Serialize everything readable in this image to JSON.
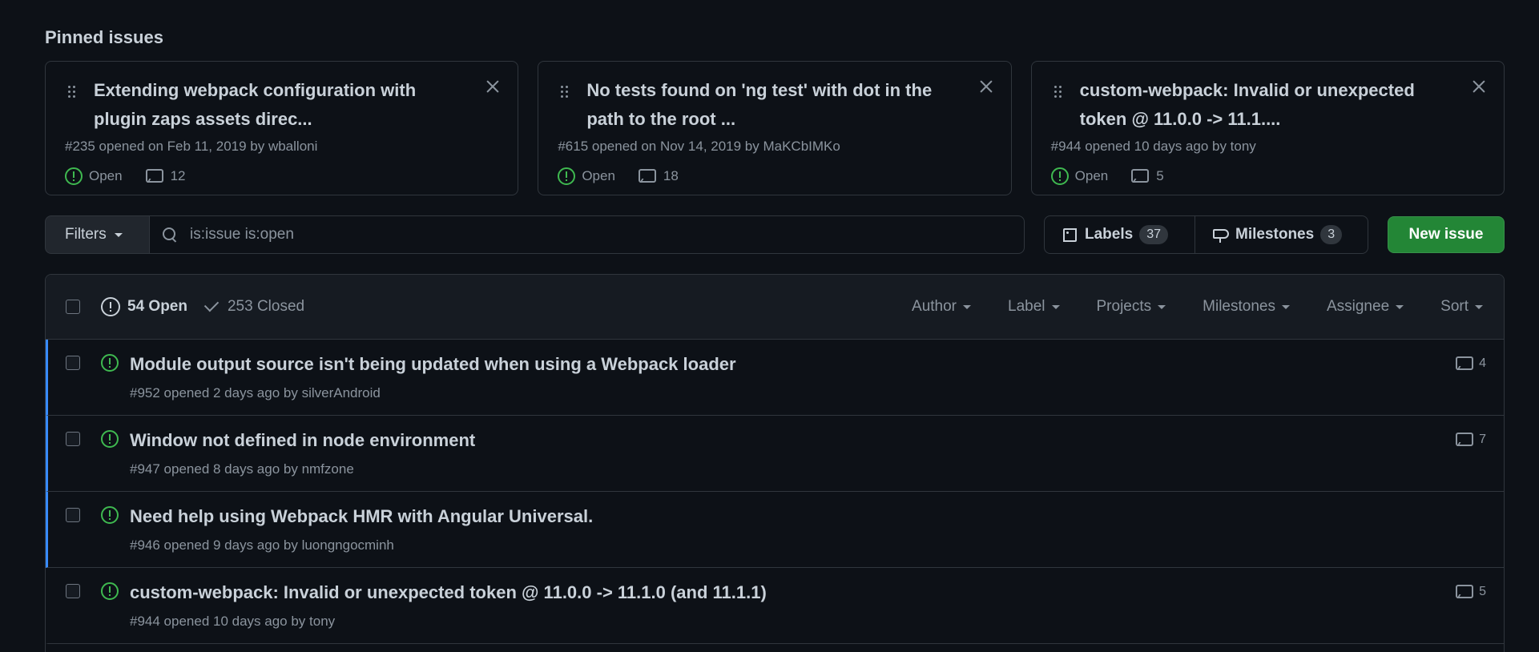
{
  "pinned": {
    "heading": "Pinned issues",
    "cards": [
      {
        "title": "Extending webpack configuration with plugin zaps assets direc...",
        "meta": "#235 opened on Feb 11, 2019 by wballoni",
        "state": "Open",
        "comments": "12"
      },
      {
        "title": "No tests found on 'ng test' with dot in the path to the root ...",
        "meta": "#615 opened on Nov 14, 2019 by MaKCbIMKo",
        "state": "Open",
        "comments": "18"
      },
      {
        "title": "custom-webpack: Invalid or unexpected token @ 11.0.0 -> 11.1....",
        "meta": "#944 opened 10 days ago by tony",
        "state": "Open",
        "comments": "5"
      }
    ]
  },
  "toolbar": {
    "filters_label": "Filters",
    "search_value": "is:issue is:open",
    "labels_label": "Labels",
    "labels_count": "37",
    "milestones_label": "Milestones",
    "milestones_count": "3",
    "new_issue_label": "New issue"
  },
  "issues_header": {
    "open_label": "54 Open",
    "closed_label": "253 Closed",
    "filters": [
      "Author",
      "Label",
      "Projects",
      "Milestones",
      "Assignee",
      "Sort"
    ]
  },
  "issues": [
    {
      "title": "Module output source isn't being updated when using a Webpack loader",
      "meta": "#952 opened 2 days ago by silverAndroid",
      "comments": "4"
    },
    {
      "title": "Window not defined in node environment",
      "meta": "#947 opened 8 days ago by nmfzone",
      "comments": "7"
    },
    {
      "title": "Need help using Webpack HMR with Angular Universal.",
      "meta": "#946 opened 9 days ago by luongngocminh",
      "comments": ""
    },
    {
      "title": "custom-webpack: Invalid or unexpected token @ 11.0.0 -> 11.1.0 (and 11.1.1)",
      "meta": "#944 opened 10 days ago by tony",
      "comments": "5"
    }
  ],
  "colors": {
    "background": "#0d1117",
    "open_green": "#3fb950",
    "button_green": "#238636",
    "unread_accent": "#388bfd"
  }
}
